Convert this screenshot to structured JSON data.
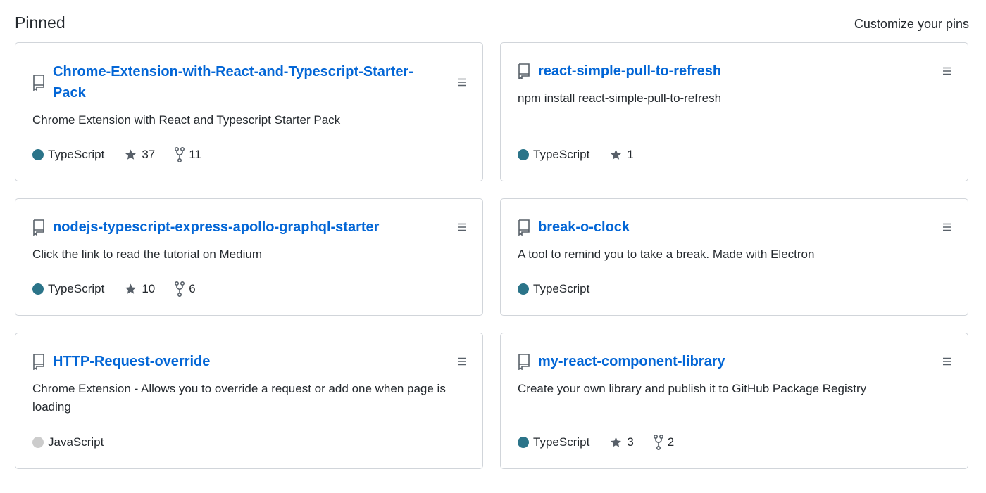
{
  "header": {
    "title": "Pinned",
    "customize_label": "Customize your pins"
  },
  "colors": {
    "link": "#0366d6",
    "typescript": "#2b7489",
    "javascript": "#cccccc",
    "border": "#d1d5da",
    "icon": "#586069"
  },
  "icons": {
    "repo": "repo-icon",
    "star": "star-icon",
    "fork": "fork-icon",
    "handle": "grabber-icon"
  },
  "pins": [
    {
      "name_line1": "Chrome-Extension-with-React-and-Typescript-Starter-",
      "name_line2": "Pack",
      "description": "Chrome Extension with React and Typescript Starter Pack",
      "language": "TypeScript",
      "stars": "37",
      "forks": "11"
    },
    {
      "name_line1": "react-simple-pull-to-refresh",
      "description": "npm install react-simple-pull-to-refresh",
      "language": "TypeScript",
      "stars": "1"
    },
    {
      "name_line1": "nodejs-typescript-express-apollo-graphql-starter",
      "description": "Click the link to read the tutorial on Medium",
      "language": "TypeScript",
      "stars": "10",
      "forks": "6"
    },
    {
      "name_line1": "break-o-clock",
      "description": "A tool to remind you to take a break. Made with Electron",
      "language": "TypeScript"
    },
    {
      "name_line1": "HTTP-Request-override",
      "description_line1": "Chrome Extension - Allows you to override a request or add one when page is",
      "description_line2": "loading",
      "language": "JavaScript"
    },
    {
      "name_line1": "my-react-component-library",
      "description": "Create your own library and publish it to GitHub Package Registry",
      "language": "TypeScript",
      "stars": "3",
      "forks": "2"
    }
  ]
}
